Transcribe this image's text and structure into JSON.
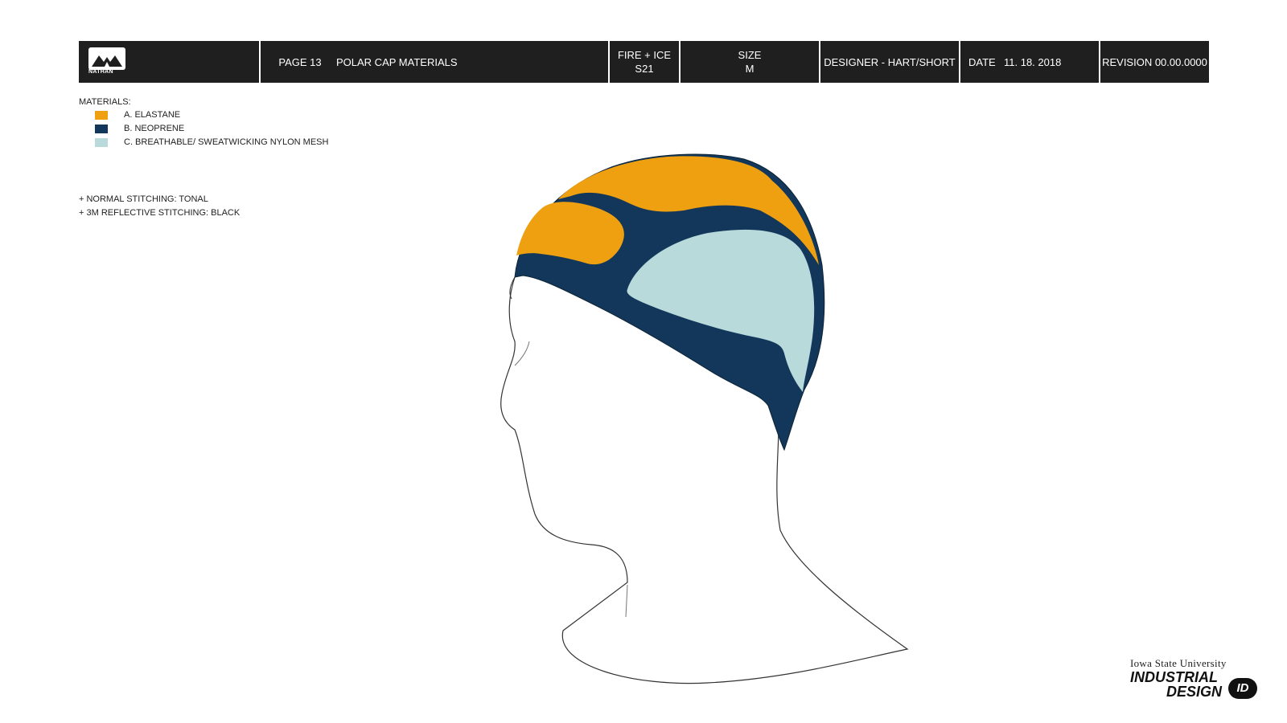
{
  "header": {
    "brand": "NATHAN",
    "page": "PAGE 13",
    "title": "POLAR CAP MATERIALS",
    "collection_line1": "FIRE + ICE",
    "collection_line2": "S21",
    "size_label": "SIZE",
    "size_value": "M",
    "designer": "DESIGNER - HART/SHORT",
    "date_label": "DATE",
    "date_value": "11. 18. 2018",
    "revision": "REVISION 00.00.0000"
  },
  "materials": {
    "heading": "MATERIALS:",
    "items": [
      {
        "label": "A.  ELASTANE",
        "color": "#eea010"
      },
      {
        "label": "B.  NEOPRENE",
        "color": "#12375a"
      },
      {
        "label": "C.  BREATHABLE/ SWEATWICKING NYLON MESH",
        "color": "#b8dadb"
      }
    ]
  },
  "stitching": {
    "normal": "+ NORMAL STITCHING: TONAL",
    "reflective": "+ 3M REFLECTIVE STITCHING: BLACK"
  },
  "footer": {
    "university": "Iowa State University",
    "dept_line1": "INDUSTRIAL",
    "dept_line2": "DESIGN",
    "badge": "ID"
  },
  "colors": {
    "header_bg": "#1f1f1f",
    "elastane": "#eea010",
    "neoprene": "#12375a",
    "mesh": "#b8dadb",
    "outline": "#333333"
  }
}
